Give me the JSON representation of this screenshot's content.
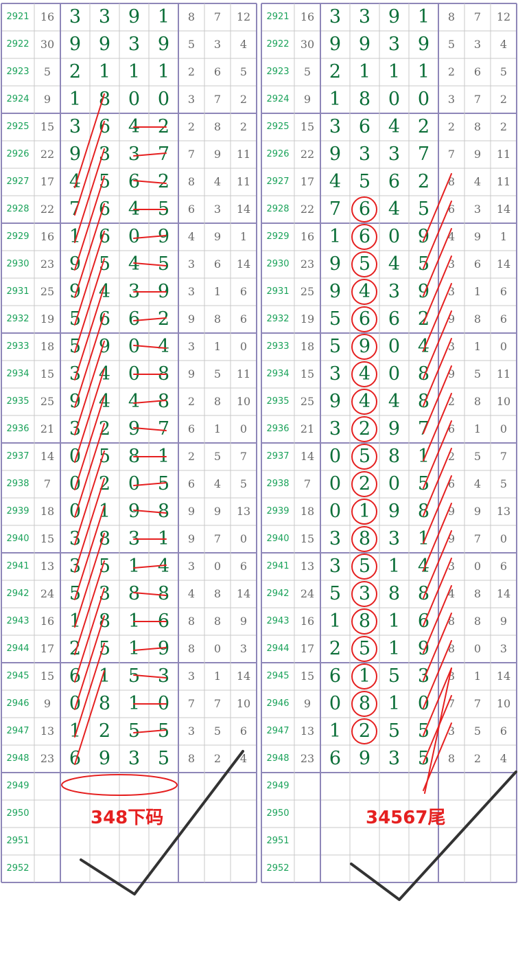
{
  "rows": [
    {
      "issue": "2921",
      "sum": "16",
      "digits": [
        "3",
        "3",
        "9",
        "1"
      ],
      "spans": [
        "8",
        "7",
        "12"
      ]
    },
    {
      "issue": "2922",
      "sum": "30",
      "digits": [
        "9",
        "9",
        "3",
        "9"
      ],
      "spans": [
        "5",
        "3",
        "4"
      ]
    },
    {
      "issue": "2923",
      "sum": "5",
      "digits": [
        "2",
        "1",
        "1",
        "1"
      ],
      "spans": [
        "2",
        "6",
        "5"
      ]
    },
    {
      "issue": "2924",
      "sum": "9",
      "digits": [
        "1",
        "8",
        "0",
        "0"
      ],
      "spans": [
        "3",
        "7",
        "2"
      ]
    },
    {
      "issue": "2925",
      "sum": "15",
      "digits": [
        "3",
        "6",
        "4",
        "2"
      ],
      "spans": [
        "2",
        "8",
        "2"
      ]
    },
    {
      "issue": "2926",
      "sum": "22",
      "digits": [
        "9",
        "3",
        "3",
        "7"
      ],
      "spans": [
        "7",
        "9",
        "11"
      ]
    },
    {
      "issue": "2927",
      "sum": "17",
      "digits": [
        "4",
        "5",
        "6",
        "2"
      ],
      "spans": [
        "8",
        "4",
        "11"
      ]
    },
    {
      "issue": "2928",
      "sum": "22",
      "digits": [
        "7",
        "6",
        "4",
        "5"
      ],
      "spans": [
        "6",
        "3",
        "14"
      ]
    },
    {
      "issue": "2929",
      "sum": "16",
      "digits": [
        "1",
        "6",
        "0",
        "9"
      ],
      "spans": [
        "4",
        "9",
        "1"
      ]
    },
    {
      "issue": "2930",
      "sum": "23",
      "digits": [
        "9",
        "5",
        "4",
        "5"
      ],
      "spans": [
        "3",
        "6",
        "14"
      ]
    },
    {
      "issue": "2931",
      "sum": "25",
      "digits": [
        "9",
        "4",
        "3",
        "9"
      ],
      "spans": [
        "3",
        "1",
        "6"
      ]
    },
    {
      "issue": "2932",
      "sum": "19",
      "digits": [
        "5",
        "6",
        "6",
        "2"
      ],
      "spans": [
        "9",
        "8",
        "6"
      ]
    },
    {
      "issue": "2933",
      "sum": "18",
      "digits": [
        "5",
        "9",
        "0",
        "4"
      ],
      "spans": [
        "3",
        "1",
        "0"
      ]
    },
    {
      "issue": "2934",
      "sum": "15",
      "digits": [
        "3",
        "4",
        "0",
        "8"
      ],
      "spans": [
        "9",
        "5",
        "11"
      ]
    },
    {
      "issue": "2935",
      "sum": "25",
      "digits": [
        "9",
        "4",
        "4",
        "8"
      ],
      "spans": [
        "2",
        "8",
        "10"
      ]
    },
    {
      "issue": "2936",
      "sum": "21",
      "digits": [
        "3",
        "2",
        "9",
        "7"
      ],
      "spans": [
        "6",
        "1",
        "0"
      ]
    },
    {
      "issue": "2937",
      "sum": "14",
      "digits": [
        "0",
        "5",
        "8",
        "1"
      ],
      "spans": [
        "2",
        "5",
        "7"
      ]
    },
    {
      "issue": "2938",
      "sum": "7",
      "digits": [
        "0",
        "2",
        "0",
        "5"
      ],
      "spans": [
        "6",
        "4",
        "5"
      ]
    },
    {
      "issue": "2939",
      "sum": "18",
      "digits": [
        "0",
        "1",
        "9",
        "8"
      ],
      "spans": [
        "9",
        "9",
        "13"
      ]
    },
    {
      "issue": "2940",
      "sum": "15",
      "digits": [
        "3",
        "8",
        "3",
        "1"
      ],
      "spans": [
        "9",
        "7",
        "0"
      ]
    },
    {
      "issue": "2941",
      "sum": "13",
      "digits": [
        "3",
        "5",
        "1",
        "4"
      ],
      "spans": [
        "3",
        "0",
        "6"
      ]
    },
    {
      "issue": "2942",
      "sum": "24",
      "digits": [
        "5",
        "3",
        "8",
        "8"
      ],
      "spans": [
        "4",
        "8",
        "14"
      ]
    },
    {
      "issue": "2943",
      "sum": "16",
      "digits": [
        "1",
        "8",
        "1",
        "6"
      ],
      "spans": [
        "8",
        "8",
        "9"
      ]
    },
    {
      "issue": "2944",
      "sum": "17",
      "digits": [
        "2",
        "5",
        "1",
        "9"
      ],
      "spans": [
        "8",
        "0",
        "3"
      ]
    },
    {
      "issue": "2945",
      "sum": "15",
      "digits": [
        "6",
        "1",
        "5",
        "3"
      ],
      "spans": [
        "3",
        "1",
        "14"
      ]
    },
    {
      "issue": "2946",
      "sum": "9",
      "digits": [
        "0",
        "8",
        "1",
        "0"
      ],
      "spans": [
        "7",
        "7",
        "10"
      ]
    },
    {
      "issue": "2947",
      "sum": "13",
      "digits": [
        "1",
        "2",
        "5",
        "5"
      ],
      "spans": [
        "3",
        "5",
        "6"
      ]
    },
    {
      "issue": "2948",
      "sum": "23",
      "digits": [
        "6",
        "9",
        "3",
        "5"
      ],
      "spans": [
        "8",
        "2",
        "4"
      ]
    },
    {
      "issue": "2949",
      "sum": "",
      "digits": [
        "",
        "",
        "",
        ""
      ],
      "spans": [
        "",
        "",
        ""
      ]
    },
    {
      "issue": "2950",
      "sum": "",
      "digits": [
        "",
        "",
        "",
        ""
      ],
      "spans": [
        "",
        "",
        ""
      ]
    },
    {
      "issue": "2951",
      "sum": "",
      "digits": [
        "",
        "",
        "",
        ""
      ],
      "spans": [
        "",
        "",
        ""
      ]
    },
    {
      "issue": "2952",
      "sum": "",
      "digits": [
        "",
        "",
        "",
        ""
      ],
      "spans": [
        "",
        "",
        ""
      ]
    }
  ],
  "annotations": {
    "left_note": "348下码",
    "right_note": "34567尾"
  },
  "colors": {
    "issue_green": "#1aa25a",
    "digit_green": "#0b6e38",
    "gray": "#6a6a6a",
    "mark_red": "#e52020",
    "grid_purple": "#8e86b8",
    "grid_light": "#c8c8c8",
    "check_black": "#333333"
  }
}
